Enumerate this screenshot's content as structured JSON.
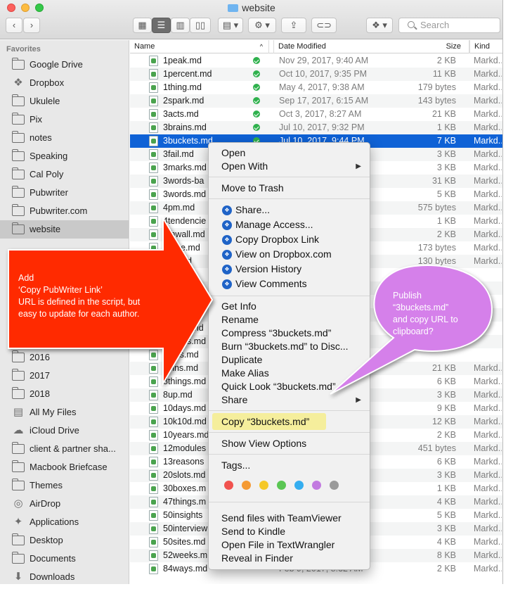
{
  "window": {
    "title": "website"
  },
  "toolbar": {
    "back": "‹",
    "forward": "›",
    "search_placeholder": "Search"
  },
  "sidebar": {
    "heading": "Favorites",
    "items": [
      {
        "label": "Google Drive",
        "icon": "folder-icon"
      },
      {
        "label": "Dropbox",
        "icon": "dropbox-icon"
      },
      {
        "label": "Ukulele",
        "icon": "folder-icon"
      },
      {
        "label": "Pix",
        "icon": "folder-icon"
      },
      {
        "label": "notes",
        "icon": "folder-icon"
      },
      {
        "label": "Speaking",
        "icon": "folder-icon"
      },
      {
        "label": "Cal Poly",
        "icon": "folder-icon"
      },
      {
        "label": "Pubwriter",
        "icon": "folder-icon"
      },
      {
        "label": "Pubwriter.com",
        "icon": "folder-icon"
      },
      {
        "label": "website",
        "icon": "folder-icon",
        "selected": true
      },
      {
        "label": "2016",
        "icon": "folder-icon"
      },
      {
        "label": "2017",
        "icon": "folder-icon"
      },
      {
        "label": "2018",
        "icon": "folder-icon"
      },
      {
        "label": "All My Files",
        "icon": "all-files-icon"
      },
      {
        "label": "iCloud Drive",
        "icon": "cloud-icon"
      },
      {
        "label": "client & partner sha...",
        "icon": "folder-icon"
      },
      {
        "label": "Macbook Briefcase",
        "icon": "folder-icon"
      },
      {
        "label": "Themes",
        "icon": "folder-icon"
      },
      {
        "label": "AirDrop",
        "icon": "airdrop-icon"
      },
      {
        "label": "Applications",
        "icon": "applications-icon"
      },
      {
        "label": "Desktop",
        "icon": "folder-icon"
      },
      {
        "label": "Documents",
        "icon": "folder-icon"
      },
      {
        "label": "Downloads",
        "icon": "downloads-icon"
      }
    ]
  },
  "columns": {
    "name": "Name",
    "date": "Date Modified",
    "size": "Size",
    "kind": "Kind"
  },
  "files": [
    {
      "name": "1peak.md",
      "date": "Nov 29, 2017, 9:40 AM",
      "size": "2 KB",
      "kind": "Markd..."
    },
    {
      "name": "1percent.md",
      "date": "Oct 10, 2017, 9:35 PM",
      "size": "11 KB",
      "kind": "Markd..."
    },
    {
      "name": "1thing.md",
      "date": "May 4, 2017, 9:38 AM",
      "size": "179 bytes",
      "kind": "Markd..."
    },
    {
      "name": "2spark.md",
      "date": "Sep 17, 2017, 6:15 AM",
      "size": "143 bytes",
      "kind": "Markd..."
    },
    {
      "name": "3acts.md",
      "date": "Oct 3, 2017, 8:27 AM",
      "size": "21 KB",
      "kind": "Markd..."
    },
    {
      "name": "3brains.md",
      "date": "Jul 10, 2017, 9:32 PM",
      "size": "1 KB",
      "kind": "Markd..."
    },
    {
      "name": "3buckets.md",
      "date": "Jul 10, 2017, 9:44 PM",
      "size": "7 KB",
      "kind": "Markd...",
      "selected": true
    },
    {
      "name": "3fail.md",
      "date": "",
      "size": "3 KB",
      "kind": "Markd..."
    },
    {
      "name": "3marks.md",
      "date": "",
      "size": "3 KB",
      "kind": "Markd..."
    },
    {
      "name": "3words-ba",
      "date": "",
      "size": "31 KB",
      "kind": "Markd..."
    },
    {
      "name": "3words.md",
      "date": "",
      "size": "5 KB",
      "kind": "Markd..."
    },
    {
      "name": "4pm.md",
      "date": "",
      "size": "575 bytes",
      "kind": "Markd..."
    },
    {
      "name": "4tendencie",
      "date": "",
      "size": "1 KB",
      "kind": "Markd..."
    },
    {
      "name": "4thwall.md",
      "date": "",
      "size": "2 KB",
      "kind": "Markd..."
    },
    {
      "name": "5wise.md",
      "date": "",
      "size": "173 bytes",
      "kind": "Markd..."
    },
    {
      "name": "5x5.md",
      "date": "",
      "size": "130 bytes",
      "kind": "Markd..."
    },
    {
      "name": "6bal.md",
      "date": "",
      "size": "",
      "kind": ""
    },
    {
      "name": "6cont.md",
      "date": "",
      "size": "",
      "kind": ""
    },
    {
      "name": "6hats.md",
      "date": "",
      "size": "",
      "kind": ""
    },
    {
      "name": "6rules.md",
      "date": "",
      "size": "",
      "kind": ""
    },
    {
      "name": "6steps.md",
      "date": "",
      "size": "",
      "kind": ""
    },
    {
      "name": "6words.md",
      "date": "",
      "size": "",
      "kind": ""
    },
    {
      "name": "7gifts.md",
      "date": "",
      "size": "",
      "kind": ""
    },
    {
      "name": "7sins.md",
      "date": "",
      "size": "21 KB",
      "kind": "Markd..."
    },
    {
      "name": "8things.md",
      "date": "",
      "size": "6 KB",
      "kind": "Markd..."
    },
    {
      "name": "8up.md",
      "date": "",
      "size": "3 KB",
      "kind": "Markd..."
    },
    {
      "name": "10days.md",
      "date": "",
      "size": "9 KB",
      "kind": "Markd..."
    },
    {
      "name": "10k10d.md",
      "date": "",
      "size": "12 KB",
      "kind": "Markd..."
    },
    {
      "name": "10years.md",
      "date": "",
      "size": "2 KB",
      "kind": "Markd..."
    },
    {
      "name": "12modules",
      "date": "",
      "size": "451 bytes",
      "kind": "Markd..."
    },
    {
      "name": "13reasons",
      "date": "",
      "size": "6 KB",
      "kind": "Markd..."
    },
    {
      "name": "20slots.md",
      "date": "",
      "size": "3 KB",
      "kind": "Markd..."
    },
    {
      "name": "30boxes.m",
      "date": "",
      "size": "1 KB",
      "kind": "Markd..."
    },
    {
      "name": "47things.m",
      "date": "",
      "size": "4 KB",
      "kind": "Markd..."
    },
    {
      "name": "50insights",
      "date": "",
      "size": "5 KB",
      "kind": "Markd..."
    },
    {
      "name": "50interview",
      "date": "",
      "size": "3 KB",
      "kind": "Markd..."
    },
    {
      "name": "50sites.md",
      "date": "",
      "size": "4 KB",
      "kind": "Markd..."
    },
    {
      "name": "52weeks.m",
      "date": "",
      "size": "8 KB",
      "kind": "Markd..."
    },
    {
      "name": "84ways.md",
      "date": "Feb 9, 2017, 8:32 AM",
      "size": "2 KB",
      "kind": "Markd..."
    }
  ],
  "context_menu": {
    "open": "Open",
    "open_with": "Open With",
    "move_to_trash": "Move to Trash",
    "dropbox": {
      "share": "Share...",
      "manage_access": "Manage Access...",
      "copy_link": "Copy Dropbox Link",
      "view_on_dropbox": "View on Dropbox.com",
      "version_history": "Version History",
      "view_comments": "View Comments"
    },
    "get_info": "Get Info",
    "rename": "Rename",
    "compress": "Compress “3buckets.md”",
    "burn": "Burn “3buckets.md” to Disc...",
    "duplicate": "Duplicate",
    "make_alias": "Make Alias",
    "quick_look": "Quick Look “3buckets.md”",
    "share": "Share",
    "copy": "Copy “3buckets.md”",
    "show_view_options": "Show View Options",
    "tags": "Tags...",
    "tag_colors": [
      "#f1524e",
      "#f59a33",
      "#f5c828",
      "#5ac653",
      "#35aef0",
      "#c27ae0",
      "#9a9a9a"
    ],
    "teamviewer": "Send files with TeamViewer",
    "kindle": "Send to Kindle",
    "textwrangler": "Open File in TextWrangler",
    "reveal": "Reveal in Finder"
  },
  "callouts": {
    "red_lines": [
      "Add",
      "‘Copy PubWriter Link’",
      "URL is defined in the script, but",
      "easy to update for each author."
    ],
    "purple_lines": [
      "Publish",
      "“3buckets.md”",
      "and copy URL to",
      "clipboard?"
    ],
    "red_color": "#ff2a00",
    "purple_color": "#d580ea"
  },
  "colors": {
    "selection": "#0f62d6",
    "sidebar_bg": "#e8e8e8"
  }
}
